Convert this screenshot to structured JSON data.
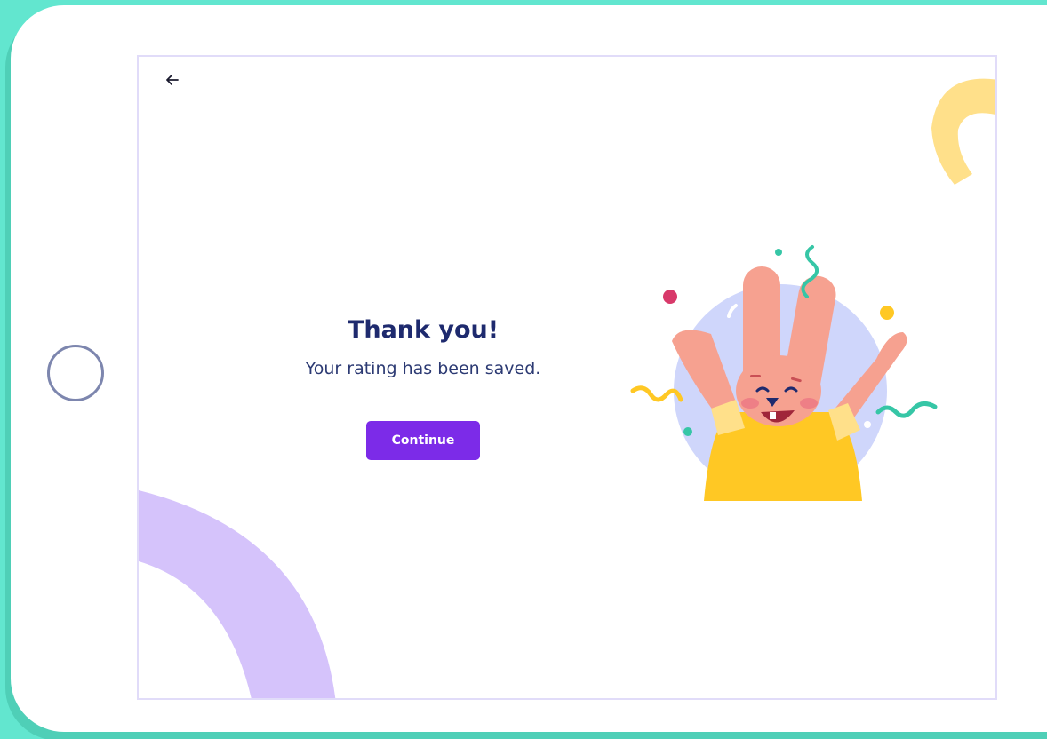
{
  "screen": {
    "title": "Thank you!",
    "message": "Your rating has been saved.",
    "continue_label": "Continue"
  },
  "navigation": {
    "back_icon": "back-arrow-icon"
  },
  "device": {
    "home_button_icon": "home-circle-icon"
  },
  "illustration": {
    "subject": "celebrating-bunny"
  },
  "colors": {
    "background": "#62e6cf",
    "accent": "#7c2be8",
    "title": "#1e2a6e",
    "decor_purple": "#d5c3fb",
    "decor_yellow": "#ffe08a"
  }
}
